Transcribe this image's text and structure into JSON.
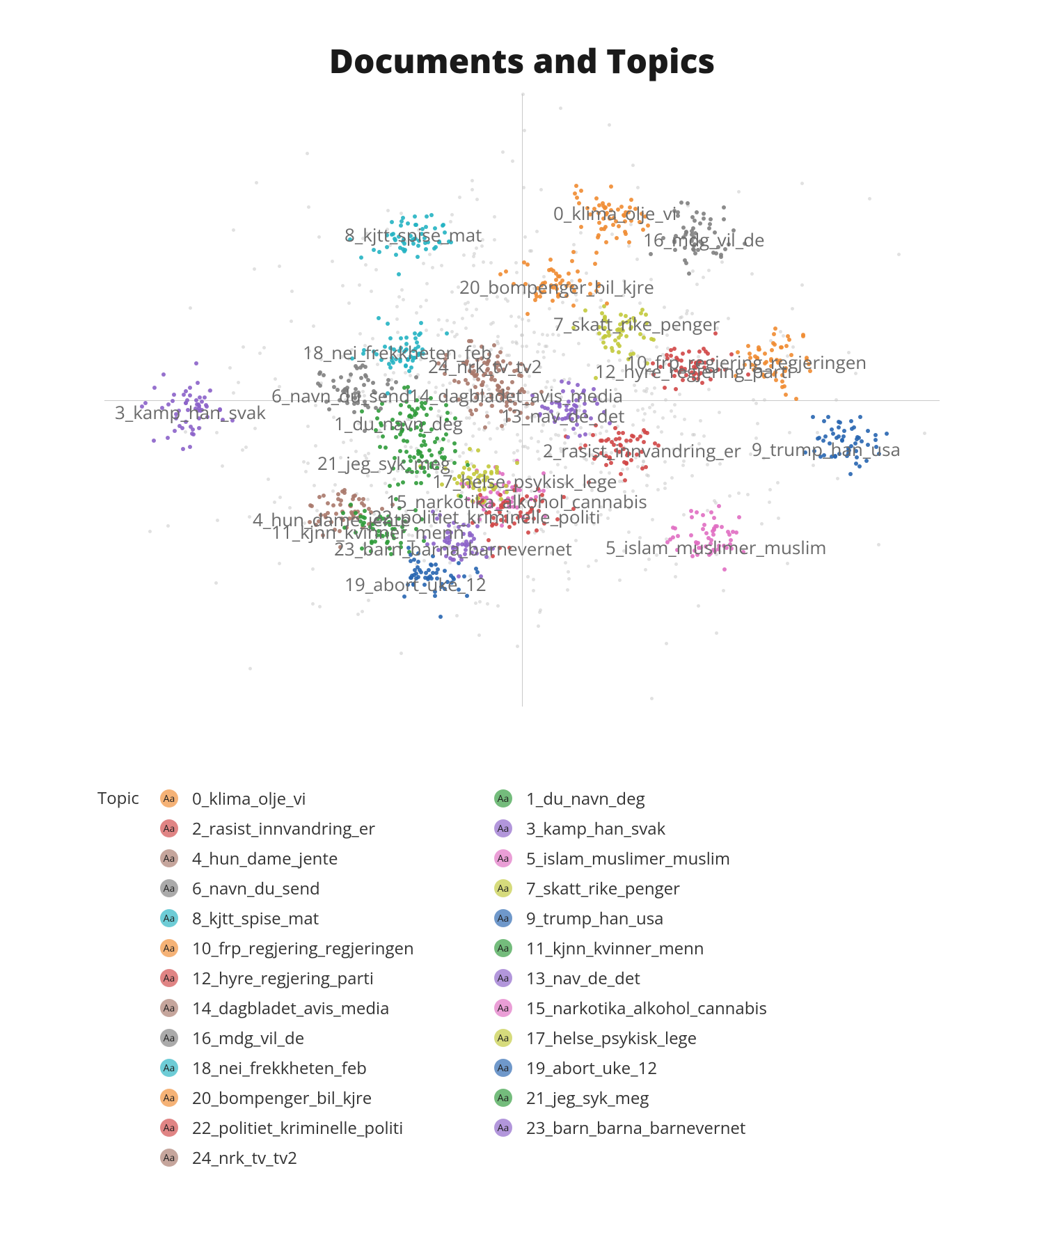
{
  "chart_data": {
    "type": "scatter",
    "title": "Documents and Topics",
    "legend_title": "Topic",
    "xlim": [
      -20,
      20
    ],
    "ylim": [
      -20,
      20
    ],
    "topics": [
      {
        "id": 0,
        "label": "0_klima_olje_vi",
        "color": "#f08b31",
        "cx": 4.5,
        "cy": 12.0
      },
      {
        "id": 1,
        "label": "1_du_navn_deg",
        "color": "#2f9b3a",
        "cx": -5.3,
        "cy": -1.2
      },
      {
        "id": 2,
        "label": "2_rasist_innvandring_er",
        "color": "#d04646",
        "cx": 4.7,
        "cy": -3.2
      },
      {
        "id": 3,
        "label": "3_kamp_han_svak",
        "color": "#8b62c9",
        "cx": -16.0,
        "cy": -0.5
      },
      {
        "id": 4,
        "label": "4_hun_dame_jente",
        "color": "#a8786a",
        "cx": -8.6,
        "cy": -7.5
      },
      {
        "id": 5,
        "label": "5_islam_muslimer_muslim",
        "color": "#e06ec2",
        "cx": 9.0,
        "cy": -9.0
      },
      {
        "id": 6,
        "label": "6_navn_du_send",
        "color": "#808080",
        "cx": -8.0,
        "cy": 0.5
      },
      {
        "id": 7,
        "label": "7_skatt_rike_penger",
        "color": "#c2c93b",
        "cx": 4.8,
        "cy": 4.5
      },
      {
        "id": 8,
        "label": "8_kjtt_spise_mat",
        "color": "#24b3c2",
        "cx": -5.4,
        "cy": 10.8
      },
      {
        "id": 9,
        "label": "9_trump_han_usa",
        "color": "#2765b0",
        "cx": 15.5,
        "cy": -2.7
      },
      {
        "id": 10,
        "label": "10_frp_regjering_regjeringen",
        "color": "#f08b31",
        "cx": 12.0,
        "cy": 2.6
      },
      {
        "id": 11,
        "label": "11_kjnn_kvinner_menn",
        "color": "#2f9b3a",
        "cx": -6.7,
        "cy": -8.2
      },
      {
        "id": 12,
        "label": "12_hyre_regjering_parti",
        "color": "#d04646",
        "cx": 8.0,
        "cy": 2.2
      },
      {
        "id": 13,
        "label": "13_nav_de_det",
        "color": "#8b62c9",
        "cx": 2.0,
        "cy": -0.7
      },
      {
        "id": 14,
        "label": "14_dagbladet_avis_media",
        "color": "#a8786a",
        "cx": -1.0,
        "cy": 0.5
      },
      {
        "id": 15,
        "label": "15_narkotika_alkohol_cannabis",
        "color": "#e06ec2",
        "cx": -1.0,
        "cy": -6.3
      },
      {
        "id": 16,
        "label": "16_mdg_vil_de",
        "color": "#808080",
        "cx": 8.4,
        "cy": 10.5
      },
      {
        "id": 17,
        "label": "17_helse_psykisk_lege",
        "color": "#c2c93b",
        "cx": -2.0,
        "cy": -5.0
      },
      {
        "id": 18,
        "label": "18_nei_frekkheten_feb",
        "color": "#24b3c2",
        "cx": -6.0,
        "cy": 3.2
      },
      {
        "id": 19,
        "label": "19_abort_uke_12",
        "color": "#2765b0",
        "cx": -4.5,
        "cy": -11.5
      },
      {
        "id": 20,
        "label": "20_bompenger_bil_kjre",
        "color": "#f08b31",
        "cx": 1.5,
        "cy": 7.5
      },
      {
        "id": 21,
        "label": "21_jeg_syk_meg",
        "color": "#2f9b3a",
        "cx": -4.5,
        "cy": -4.0
      },
      {
        "id": 22,
        "label": "22_politiet_kriminelle_politi",
        "color": "#d04646",
        "cx": -0.3,
        "cy": -7.4
      },
      {
        "id": 23,
        "label": "23_barn_barna_barnevernet",
        "color": "#8b62c9",
        "cx": -3.0,
        "cy": -9.3
      },
      {
        "id": 24,
        "label": "24_nrk_tv_tv2",
        "color": "#a8786a",
        "cx": -2.0,
        "cy": 2.2
      }
    ],
    "label_anchors": [
      {
        "id": 0,
        "x": 1.5,
        "y": 12.4
      },
      {
        "id": 1,
        "x": -9.0,
        "y": -1.3
      },
      {
        "id": 2,
        "x": 1.0,
        "y": -3.1
      },
      {
        "id": 3,
        "x": -19.5,
        "y": -0.6
      },
      {
        "id": 4,
        "x": -12.9,
        "y": -7.6
      },
      {
        "id": 5,
        "x": 4.0,
        "y": -9.4
      },
      {
        "id": 6,
        "x": -12.0,
        "y": 0.5
      },
      {
        "id": 7,
        "x": 1.5,
        "y": 5.2
      },
      {
        "id": 8,
        "x": -8.5,
        "y": 11.0
      },
      {
        "id": 9,
        "x": 11.0,
        "y": -3.0
      },
      {
        "id": 10,
        "x": 5.0,
        "y": 2.7
      },
      {
        "id": 11,
        "x": -12.0,
        "y": -8.4
      },
      {
        "id": 12,
        "x": 3.5,
        "y": 2.1
      },
      {
        "id": 13,
        "x": -1.0,
        "y": -0.8
      },
      {
        "id": 14,
        "x": -5.4,
        "y": 0.5
      },
      {
        "id": 15,
        "x": -6.5,
        "y": -6.4
      },
      {
        "id": 16,
        "x": 5.8,
        "y": 10.7
      },
      {
        "id": 17,
        "x": -4.3,
        "y": -5.1
      },
      {
        "id": 18,
        "x": -10.5,
        "y": 3.3
      },
      {
        "id": 19,
        "x": -8.5,
        "y": -11.8
      },
      {
        "id": 20,
        "x": -3.0,
        "y": 7.6
      },
      {
        "id": 21,
        "x": -9.8,
        "y": -3.9
      },
      {
        "id": 22,
        "x": -7.2,
        "y": -7.4
      },
      {
        "id": 23,
        "x": -9.0,
        "y": -9.5
      },
      {
        "id": 24,
        "x": -4.5,
        "y": 2.4
      }
    ],
    "noise_points_approx": 700,
    "topic_points_per_cluster_approx": 55
  }
}
